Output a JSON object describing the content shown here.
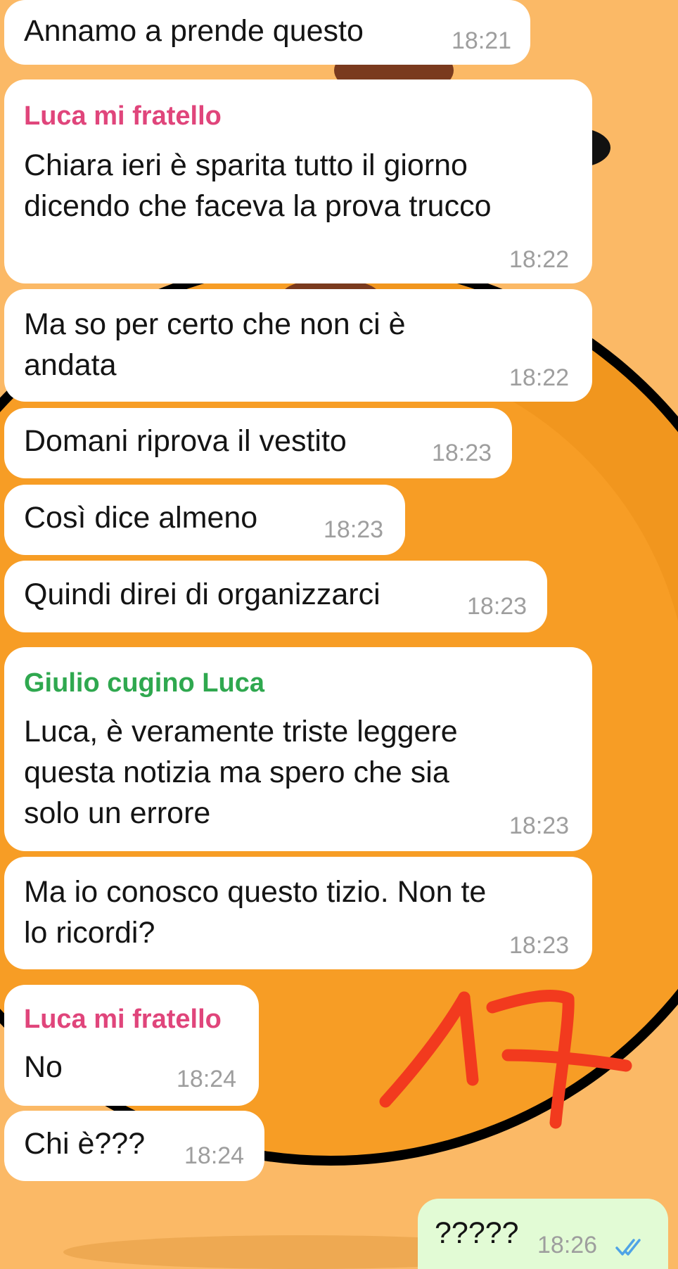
{
  "chat": {
    "messages": [
      {
        "text": "Annamo a prende questo",
        "time": "18:21"
      },
      {
        "sender": "Luca mi fratello",
        "sender_color": "#e0457b",
        "text": "Chiara ieri è sparita tutto il giorno\ndicendo che faceva la prova trucco",
        "time": "18:22"
      },
      {
        "text": "Ma so per certo che non ci è\nandata",
        "time": "18:22"
      },
      {
        "text": "Domani riprova il vestito",
        "time": "18:23"
      },
      {
        "text": "Così dice almeno",
        "time": "18:23"
      },
      {
        "text": "Quindi direi di organizzarci",
        "time": "18:23"
      },
      {
        "sender": "Giulio cugino Luca",
        "sender_color": "#2fa84f",
        "text": "Luca, è veramente triste leggere\nquesta notizia ma spero che sia\nsolo un errore",
        "time": "18:23"
      },
      {
        "text": "Ma io conosco questo tizio. Non te\nlo ricordi?",
        "time": "18:23"
      },
      {
        "sender": "Luca mi fratello",
        "sender_color": "#e0457b",
        "text": "No",
        "time": "18:24"
      },
      {
        "text": "Chi è???",
        "time": "18:24"
      },
      {
        "text": "?????",
        "time": "18:26",
        "outgoing": true,
        "status": "read-double-check-icon"
      }
    ]
  },
  "annotation": {
    "text": "17",
    "color": "#f23a1e"
  },
  "colors": {
    "wallpaper": "#fbb966",
    "incoming_bubble": "#ffffff",
    "outgoing_bubble": "#e2fbd5",
    "read_ticks": "#4fa3e6",
    "timestamp": "#9e9e9e"
  }
}
